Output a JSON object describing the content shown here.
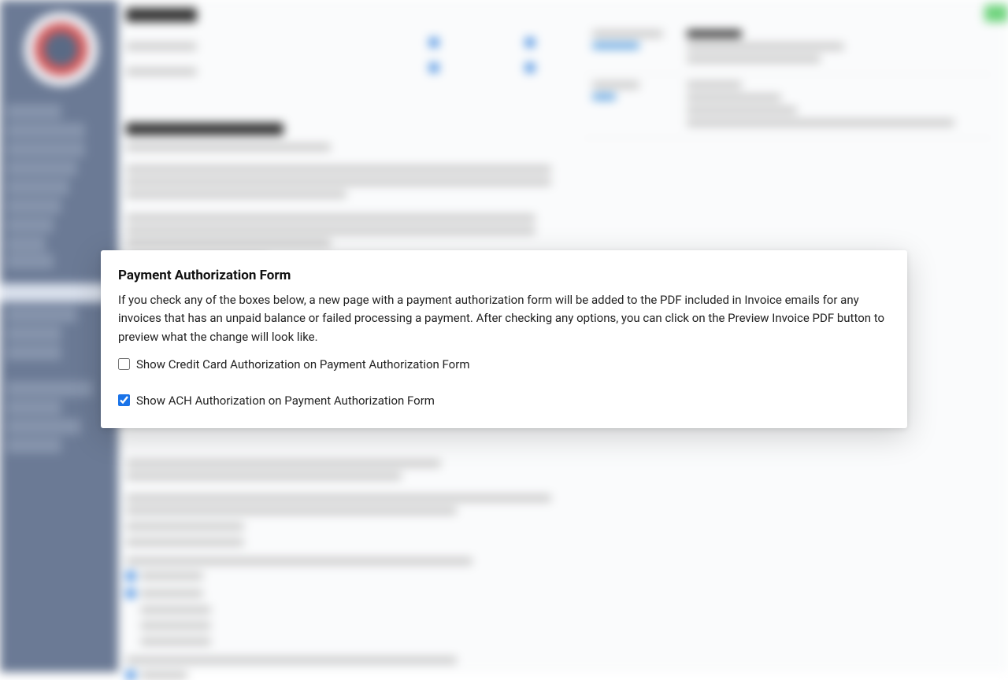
{
  "modal": {
    "title": "Payment Authorization Form",
    "description": "If you check any of the boxes below, a new page with a payment authorization form will be added to the PDF included in Invoice emails for any invoices that has an unpaid balance or failed processing a payment. After checking any options, you can click on the Preview Invoice PDF button to preview what the change will look like.",
    "checkbox_cc_label": "Show Credit Card Authorization on Payment Authorization Form",
    "checkbox_cc_checked": false,
    "checkbox_ach_label": "Show ACH Authorization on Payment Authorization Form",
    "checkbox_ach_checked": true
  }
}
